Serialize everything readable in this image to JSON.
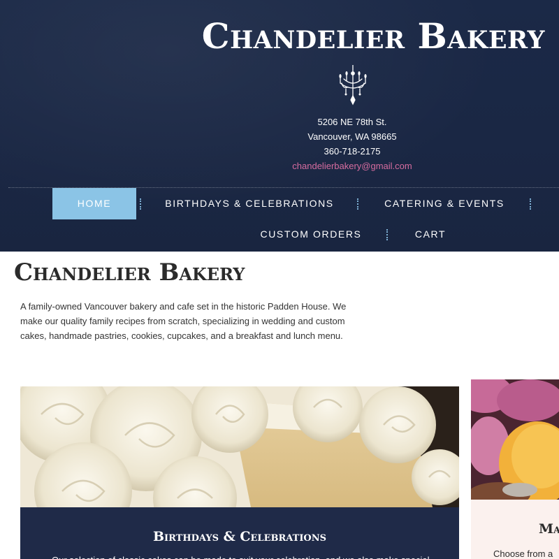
{
  "site": {
    "title": "Chandelier Bakery",
    "logo_icon": "chandelier-icon"
  },
  "contact": {
    "address_line1": "5206 NE 78th St.",
    "address_line2": "Vancouver, WA 98665",
    "phone": "360-718-2175",
    "email": "chandelierbakery@gmail.com"
  },
  "nav": {
    "items": [
      {
        "label": "HOME",
        "active": true
      },
      {
        "label": "BIRTHDAYS & CELEBRATIONS",
        "active": false
      },
      {
        "label": "CATERING & EVENTS",
        "active": false
      },
      {
        "label": "CUSTOM ORDERS",
        "active": false
      },
      {
        "label": "CART",
        "active": false
      }
    ]
  },
  "main": {
    "title": "Chandelier Bakery",
    "intro": "A family-owned Vancouver bakery and cafe set in the historic Padden House. We make our quality family recipes from scratch, specializing in wedding and custom cakes, handmade pastries, cookies, cupcakes, and a breakfast and lunch menu."
  },
  "cards": [
    {
      "title": "Birthdays & Celebrations",
      "description": "Our selection of classic cakes can be made to suit your celebration, and we also make special",
      "image": "frosted-cake-photo"
    },
    {
      "title": "Ma",
      "description": "Choose from a",
      "image": "macarons-photo"
    }
  ],
  "colors": {
    "header_bg": "#1b2947",
    "nav_active": "#8bc4e6",
    "email_link": "#d66c9f",
    "card_caption_dark": "#1f2a48",
    "card_caption_light": "#fbf1ee"
  }
}
